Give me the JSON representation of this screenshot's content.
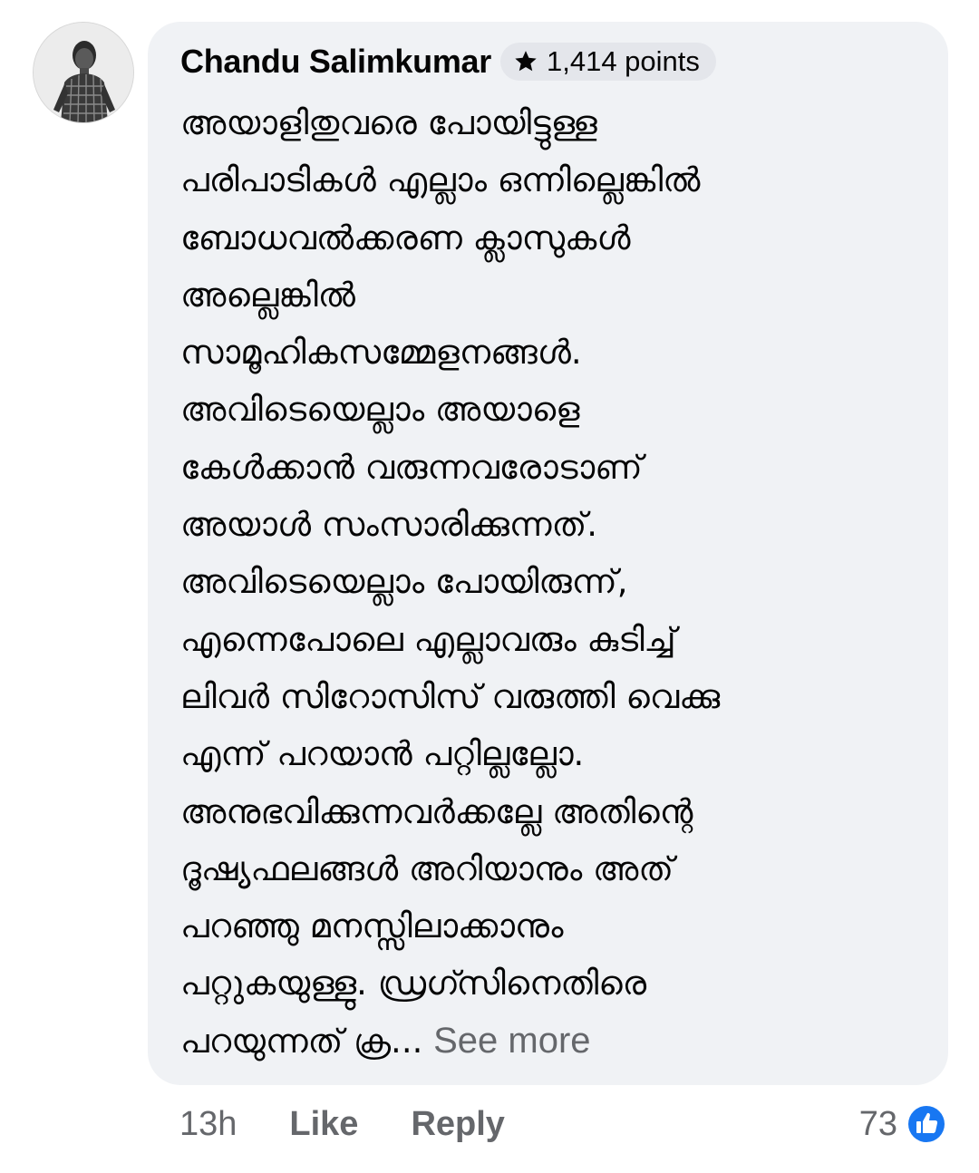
{
  "comment": {
    "author": "Chandu Salimkumar",
    "points_badge": {
      "icon": "star-icon",
      "label": "1,414 points"
    },
    "body_lines": [
      "അയാളിതുവരെ പോയിട്ടുള്ള",
      "പരിപാടികൾ എല്ലാം ഒന്നില്ലെങ്കിൽ",
      "ബോധവൽക്കരണ ക്ലാസുകൾ",
      "അല്ലെങ്കിൽ",
      "സാമൂഹികസമ്മേളനങ്ങൾ.",
      "അവിടെയെല്ലാം അയാളെ",
      "കേൾക്കാൻ വരുന്നവരോടാണ്",
      "അയാൾ സംസാരിക്കുന്നത്.",
      "അവിടെയെല്ലാം പോയിരുന്ന്,",
      "എന്നെപോലെ എല്ലാവരും കുടിച്ച്",
      "ലിവർ സിറോസിസ് വരുത്തി വെക്കു",
      "എന്ന് പറയാൻ പറ്റില്ലല്ലോ.",
      "അനുഭവിക്കുന്നവർക്കല്ലേ അതിന്റെ",
      "ദൂഷ്യഫലങ്ങൾ അറിയാനും അത്",
      "പറഞ്ഞു മനസ്സിലാക്കാനും",
      "പറ്റുകയുള്ളു. ഡ്രഗ്സിനെതിരെ",
      "പറയുന്നത് ക്ര..."
    ],
    "see_more": "See more",
    "timestamp": "13h",
    "like_label": "Like",
    "reply_label": "Reply",
    "reaction_count": "73",
    "reaction_icon": "like-reaction-icon"
  },
  "colors": {
    "bubble_bg": "#f0f2f5",
    "badge_bg": "#e4e6eb",
    "text_primary": "#050505",
    "text_secondary": "#65676b",
    "like_blue": "#1877f2"
  }
}
